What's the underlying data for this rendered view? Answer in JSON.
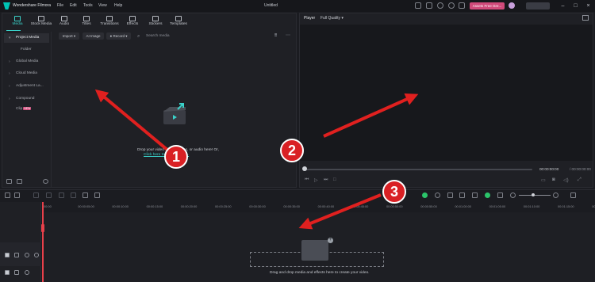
{
  "app": {
    "name": "Wondershare Filmora",
    "document_title": "Untitled"
  },
  "menu": [
    "File",
    "Edit",
    "Tools",
    "View",
    "Help"
  ],
  "upgrade_label": "Assets Free Gre...",
  "tabs": [
    {
      "label": "Media",
      "icon": "media-icon",
      "active": true
    },
    {
      "label": "Stock Media",
      "icon": "stock-media-icon"
    },
    {
      "label": "Audio",
      "icon": "audio-icon"
    },
    {
      "label": "Titles",
      "icon": "titles-icon"
    },
    {
      "label": "Transitions",
      "icon": "transitions-icon"
    },
    {
      "label": "Effects",
      "icon": "effects-icon"
    },
    {
      "label": "Stickers",
      "icon": "stickers-icon"
    },
    {
      "label": "Templates",
      "icon": "templates-icon"
    }
  ],
  "sidebar": {
    "items": [
      {
        "label": "Project Media"
      },
      {
        "label": "Folder"
      },
      {
        "label": "Global Media"
      },
      {
        "label": "Cloud Media"
      },
      {
        "label": "Adjustment La..."
      },
      {
        "label": "Compound Clip",
        "badge": "NEW"
      }
    ]
  },
  "media_toolbar": {
    "import": "Import",
    "ai_image": "AI Image",
    "record": "Record",
    "search_placeholder": "Search media"
  },
  "dropzone": {
    "line1": "Drop your video clips, images, or audio here! Or,",
    "link": "Click here to import media."
  },
  "player": {
    "label": "Player",
    "quality": "Full Quality",
    "timecode_current": "00:00:00:00",
    "timecode_total": "/ 00:00:00:00"
  },
  "timeline": {
    "ruler_ticks": [
      "00:00",
      "00:00:05:00",
      "00:00:10:00",
      "00:00:15:00",
      "00:00:20:00",
      "00:00:25:00",
      "00:00:30:00",
      "00:00:35:00",
      "00:00:40:00",
      "00:00:45:00",
      "00:00:50:00",
      "00:00:55:00",
      "00:01:00:00",
      "00:01:05:00",
      "00:01:10:00",
      "00:01:15:00",
      "00:01:20:00"
    ],
    "drop_text": "Drag and drop media and effects here to create your video."
  },
  "annotations": [
    "1",
    "2",
    "3"
  ],
  "colors": {
    "accent": "#3ad1c9",
    "marker": "#d92024",
    "playhead": "#e8404a",
    "upgrade": "#d04a7a"
  }
}
